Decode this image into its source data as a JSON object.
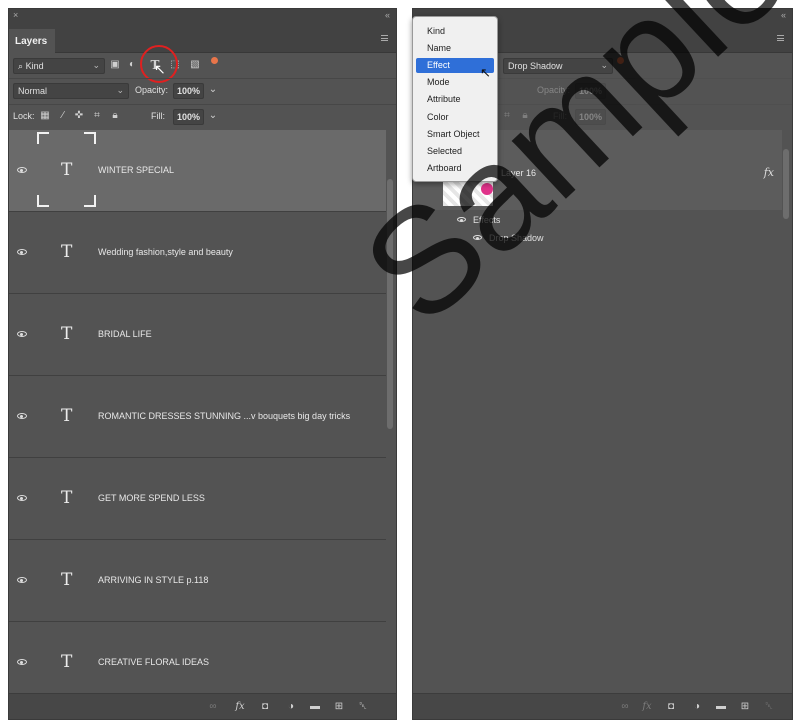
{
  "left_panel": {
    "title_close": "×",
    "title_collapse": "«",
    "tab_label": "Layers",
    "filter_kind": "Kind",
    "blend_mode": "Normal",
    "opacity_label": "Opacity:",
    "opacity_value": "100%",
    "lock_label": "Lock:",
    "fill_label": "Fill:",
    "fill_value": "100%",
    "layers": [
      {
        "name": "WINTER SPECIAL",
        "glyph": "T"
      },
      {
        "name": "Wedding fashion,style and beauty",
        "glyph": "T"
      },
      {
        "name": "BRIDAL LIFE",
        "glyph": "T"
      },
      {
        "name": "ROMANTIC DRESSES STUNNING ...v bouquets big day tricks",
        "glyph": "T"
      },
      {
        "name": "GET MORE SPEND LESS",
        "glyph": "T"
      },
      {
        "name": "ARRIVING IN STYLE p.118",
        "glyph": "T"
      },
      {
        "name": "CREATIVE FLORAL IDEAS",
        "glyph": "T"
      }
    ],
    "selected_layer_index": 0
  },
  "right_panel": {
    "title_collapse": "«",
    "filter_value": "Drop Shadow",
    "opacity_label": "Opacity:",
    "opacity_value": "100%",
    "fill_label": "Fill:",
    "fill_value": "100%",
    "layer_name": "Layer 16",
    "fx_label": "fx",
    "effects_label": "Effects",
    "effect_item": "Drop Shadow"
  },
  "filter_menu": {
    "items": [
      "Kind",
      "Name",
      "Effect",
      "Mode",
      "Attribute",
      "Color",
      "Smart Object",
      "Selected",
      "Artboard"
    ],
    "highlighted": "Effect"
  },
  "watermark": "Sample pa",
  "colors": {
    "panel_bg": "#535353",
    "selected_row": "#6a6a6a",
    "menu_highlight": "#2f6fd8",
    "highlight_circle": "#e02020",
    "orange_dot": "#e8754a",
    "pink_dot": "#e0338a"
  }
}
